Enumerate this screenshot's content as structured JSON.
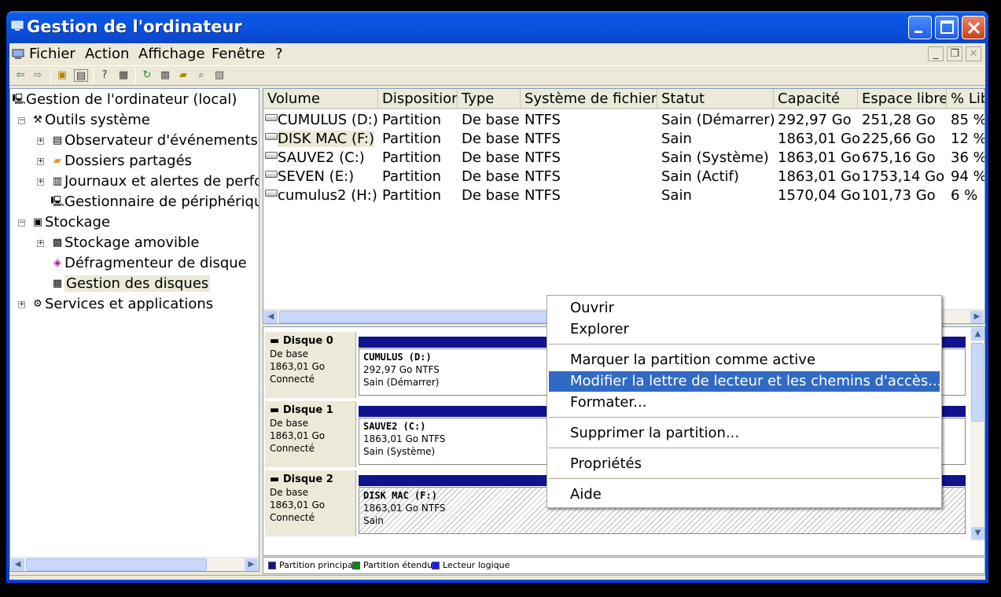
{
  "window": {
    "title": "Gestion de l'ordinateur"
  },
  "menu": [
    "Fichier",
    "Action",
    "Affichage",
    "Fenêtre",
    "?"
  ],
  "mdi_buttons": [
    "_",
    "❐",
    "✕"
  ],
  "tree": [
    {
      "label": "Gestion de l'ordinateur (local)",
      "icon": "computer-icon"
    },
    {
      "label": "Outils système",
      "icon": "tools-icon"
    },
    {
      "label": "Observateur d'événements",
      "icon": "event-viewer-icon"
    },
    {
      "label": "Dossiers partagés",
      "icon": "shared-folder-icon"
    },
    {
      "label": "Journaux et alertes de perfo",
      "icon": "performance-icon"
    },
    {
      "label": "Gestionnaire de périphérique",
      "icon": "device-manager-icon"
    },
    {
      "label": "Stockage",
      "icon": "storage-icon"
    },
    {
      "label": "Stockage amovible",
      "icon": "removable-storage-icon"
    },
    {
      "label": "Défragmenteur de disque",
      "icon": "defrag-icon"
    },
    {
      "label": "Gestion des disques",
      "icon": "disk-management-icon"
    },
    {
      "label": "Services et applications",
      "icon": "services-icon"
    }
  ],
  "volume_table": {
    "columns": [
      "Volume",
      "Disposition",
      "Type",
      "Système de fichiers",
      "Statut",
      "Capacité",
      "Espace libre",
      "% Lib"
    ],
    "rows": [
      [
        "CUMULUS (D:)",
        "Partition",
        "De base",
        "NTFS",
        "Sain (Démarrer)",
        "292,97 Go",
        "251,28 Go",
        "85 %"
      ],
      [
        "DISK MAC (F:)",
        "Partition",
        "De base",
        "NTFS",
        "Sain",
        "1863,01 Go",
        "225,66 Go",
        "12 %"
      ],
      [
        "SAUVE2 (C:)",
        "Partition",
        "De base",
        "NTFS",
        "Sain (Système)",
        "1863,01 Go",
        "675,16 Go",
        "36 %"
      ],
      [
        "SEVEN (E:)",
        "Partition",
        "De base",
        "NTFS",
        "Sain (Actif)",
        "1863,01 Go",
        "1753,14 Go",
        "94 %"
      ],
      [
        "cumulus2 (H:)",
        "Partition",
        "De base",
        "NTFS",
        "Sain",
        "1570,04 Go",
        "101,73 Go",
        "6 %"
      ]
    ]
  },
  "disks": [
    {
      "name": "Disque 0",
      "type": "De base",
      "size": "1863,01 Go",
      "state": "Connecté",
      "partition": {
        "name": "CUMULUS  (D:)",
        "info": "292,97 Go NTFS",
        "status": "Sain (Démarrer)"
      }
    },
    {
      "name": "Disque 1",
      "type": "De base",
      "size": "1863,01 Go",
      "state": "Connecté",
      "partition": {
        "name": "SAUVE2  (C:)",
        "info": "1863,01 Go NTFS",
        "status": "Sain (Système)"
      }
    },
    {
      "name": "Disque 2",
      "type": "De base",
      "size": "1863,01 Go",
      "state": "Connecté",
      "partition": {
        "name": "DISK MAC  (F:)",
        "info": "1863,01 Go NTFS",
        "status": "Sain"
      }
    }
  ],
  "legend": [
    {
      "label": "Partition principale",
      "color": "#10128e"
    },
    {
      "label": "Partition étendue",
      "color": "#0a8a0a"
    },
    {
      "label": "Lecteur logique",
      "color": "#1a1aff"
    }
  ],
  "context_menu": {
    "items": [
      "Ouvrir",
      "Explorer",
      "Marquer la partition comme active",
      "Modifier la lettre de lecteur et les chemins d'accès...",
      "Formater...",
      "Supprimer la partition...",
      "Propriétés",
      "Aide"
    ],
    "highlighted": "Modifier la lettre de lecteur et les chemins d'accès..."
  }
}
